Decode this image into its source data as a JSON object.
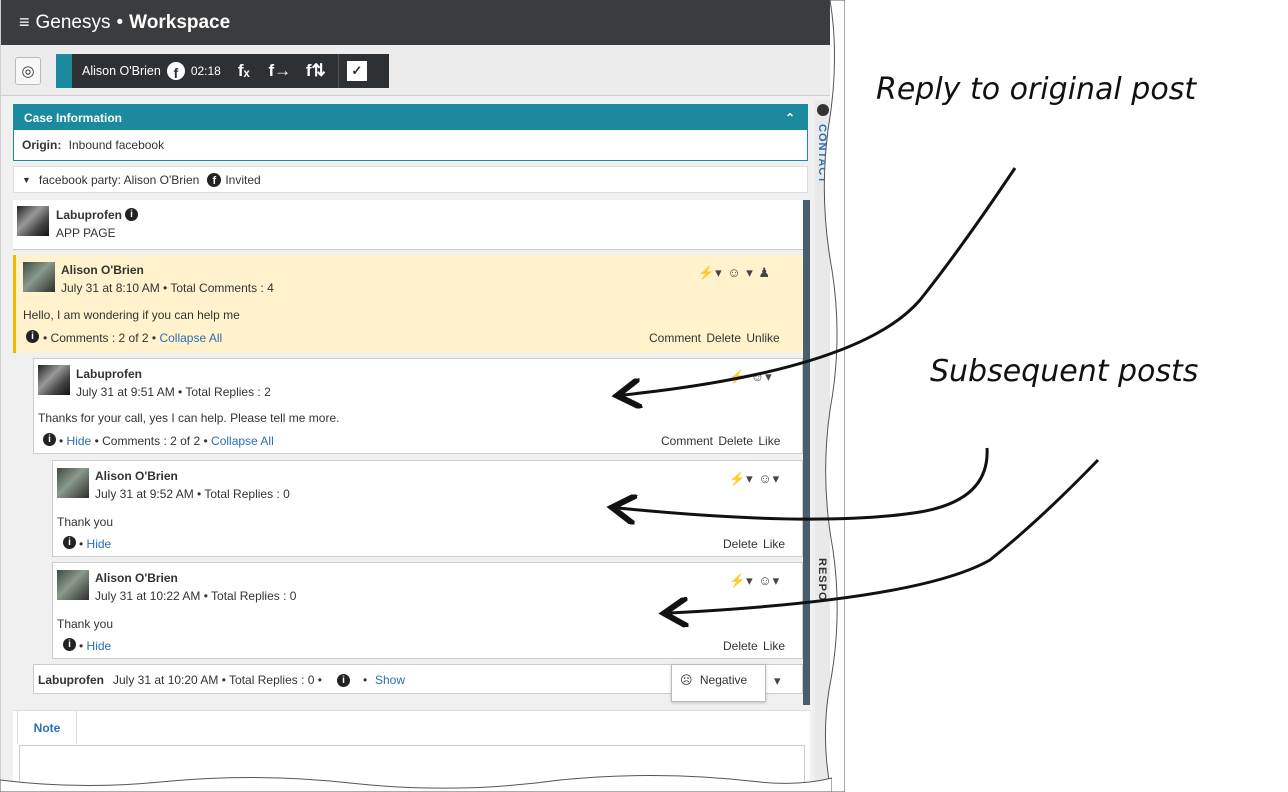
{
  "titlebar": {
    "brand": "Genesys",
    "separator": "•",
    "product": "Workspace"
  },
  "toolbar": {
    "contact_name": "Alison O'Brien",
    "timer": "02:18",
    "fb": "f"
  },
  "case": {
    "title": "Case Information",
    "origin_label": "Origin:",
    "origin_value": "Inbound facebook"
  },
  "party": {
    "text": "facebook party: Alison O'Brien",
    "status": "Invited"
  },
  "page_post": {
    "name": "Labuprofen",
    "sub": "APP PAGE"
  },
  "posts": [
    {
      "name": "Alison O'Brien",
      "meta": "July 31 at 8:10 AM • Total Comments : 4",
      "text": "Hello, I am wondering if you can help me",
      "footer": "• Comments : 2 of 2 •",
      "footer_link": "Collapse All",
      "actions": "Comment  Delete  Unlike"
    },
    {
      "name": "Labuprofen",
      "meta": "July 31 at 9:51 AM • Total Replies : 2",
      "text": "Thanks for your call, yes I can help. Please tell me more.",
      "footer_link1": "Hide",
      "footer": "• Comments : 2 of 2 •",
      "footer_link": "Collapse All",
      "actions": "Comment  Delete  Like"
    },
    {
      "name": "Alison O'Brien",
      "meta": "July 31 at 9:52 AM • Total Replies : 0",
      "text": "Thank you",
      "footer_link1": "Hide",
      "actions": "Delete  Like"
    },
    {
      "name": "Alison O'Brien",
      "meta": "July 31 at 10:22 AM • Total Replies : 0",
      "text": "Thank you",
      "footer_link1": "Hide",
      "actions": "Delete  Like"
    }
  ],
  "collapsed": {
    "name": "Labuprofen",
    "meta": "July 31 at 10:20 AM • Total Replies : 0 •",
    "link": "Show"
  },
  "popup": {
    "item": "Negative"
  },
  "note": {
    "tab": "Note"
  },
  "side": {
    "contact": "CONTACT",
    "responses": "RESPO"
  },
  "annotations": {
    "reply": "Reply to original post",
    "subsequent": "Subsequent posts"
  },
  "dot": "•"
}
